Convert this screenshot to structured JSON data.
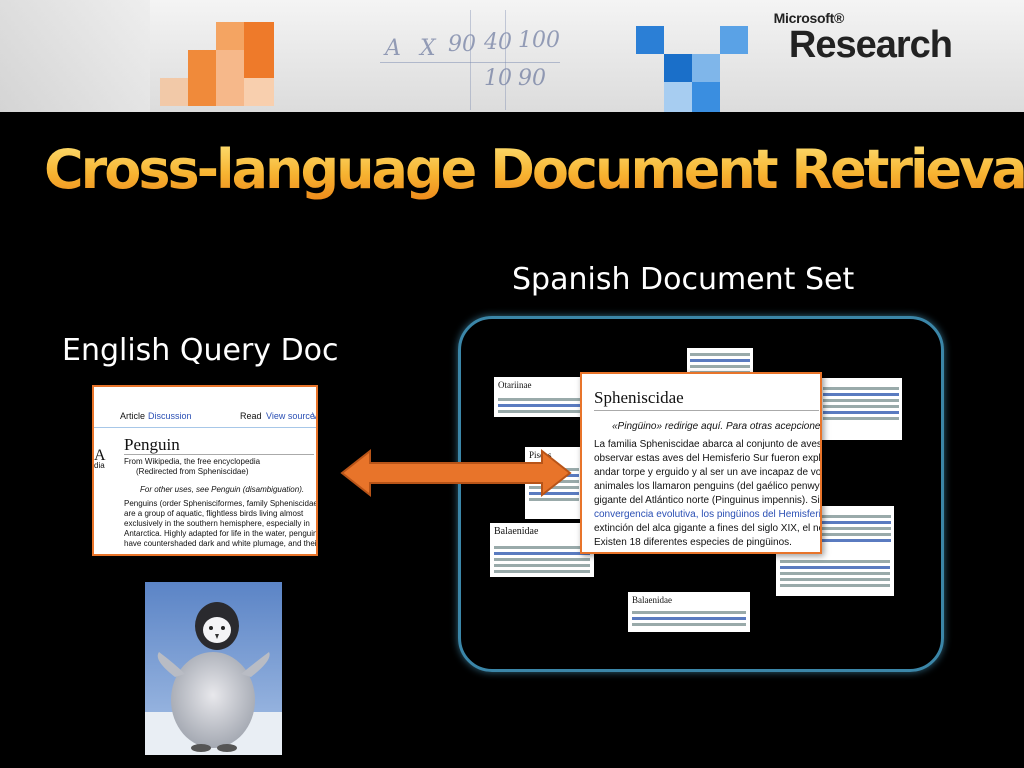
{
  "header": {
    "logo_small": "Microsoft®",
    "logo_big": "Research",
    "scribbles": [
      "A",
      "X",
      "90",
      "40",
      "100",
      "10",
      "90"
    ]
  },
  "slide": {
    "title": "Cross-language Document Retrieval",
    "english_label": "English Query Doc",
    "spanish_label": "Spanish Document Set"
  },
  "english_doc": {
    "tab_article": "Article",
    "tab_discussion": "Discussion",
    "tab_read": "Read",
    "tab_view_source": "View source",
    "tab_v": "V",
    "side_letter": "A",
    "side_text": "dia",
    "title": "Penguin",
    "line1": "From Wikipedia, the free encyclopedia",
    "line2": "(Redirected from Spheniscidae)",
    "line3": "For other uses, see Penguin (disambiguation).",
    "p1": "Penguins (order Sphenisciformes, family Spheniscidae)",
    "p2": "are a group of aquatic, flightless birds living almost",
    "p3": "exclusively in the southern hemisphere, especially in",
    "p4": "Antarctica. Highly adapted for life in the water, penguins",
    "p5": "have countershaded dark and white plumage, and their"
  },
  "spanish_docs": {
    "main_title": "Spheniscidae",
    "l1": "«Pingüino» redirige aquí. Para otras acepciones, v",
    "l2": "La familia Spheniscidae abarca al conjunto de aves m",
    "l3": "observar estas aves del Hemisferio Sur fueron explora",
    "l4": "andar torpe y erguido y al ser un ave incapaz de volar,",
    "l5": "animales los llamaron penguins (del gaélico penwyn, p",
    "l6": "gigante del Atlántico norte (Pinguinus impennis). Sin e",
    "l7": "convergencia evolutiva, los pingüinos del Hemisferio N",
    "l8": "extinción del alca gigante a fines del siglo XIX, el nomb",
    "l9": "Existen 18 diferentes especies de pingüinos.",
    "otariinae": "Otariinae",
    "balaenidae": "Balaenidae",
    "balaenidae2": "Balaenidae",
    "pisces": "Pisces"
  },
  "colors": {
    "title_gradient_top": "#fde37a",
    "title_gradient_bottom": "#ee8a1a",
    "frame_border": "#3b86a8",
    "doc_border": "#e8742a",
    "arrow_fill": "#e8742a",
    "link_blue": "#2a4fb4"
  }
}
